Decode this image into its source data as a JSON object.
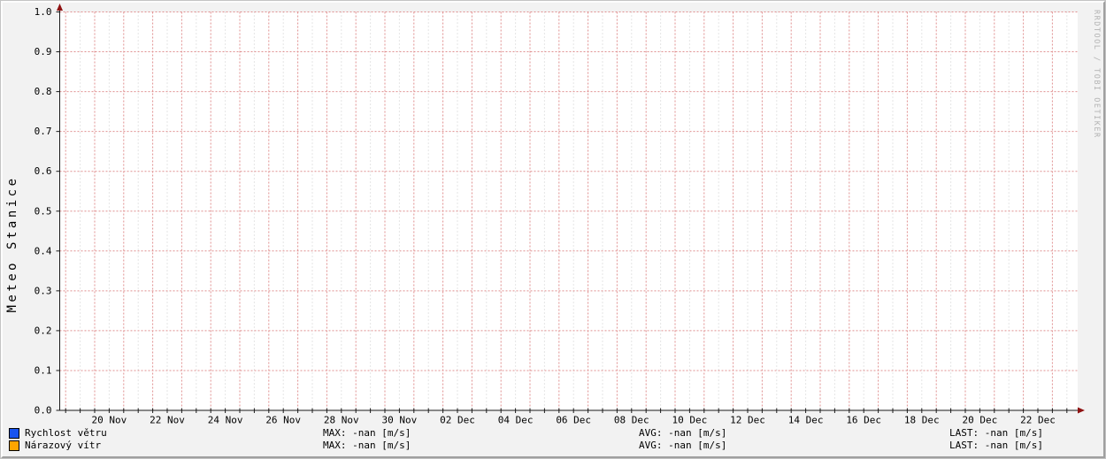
{
  "window": {
    "background_color": "#f2f2f2",
    "plot_background_color": "#ffffff"
  },
  "chart_data": {
    "type": "line",
    "title": "",
    "ylabel": "Meteo Stanice",
    "xlabel": "",
    "ylim": [
      0.0,
      1.0
    ],
    "y_tick_interval": 0.1,
    "y_tick_labels": [
      "0.0",
      "0.1",
      "0.2",
      "0.3",
      "0.4",
      "0.5",
      "0.6",
      "0.7",
      "0.8",
      "0.9",
      "1.0"
    ],
    "x_tick_labels": [
      "20 Nov",
      "22 Nov",
      "24 Nov",
      "26 Nov",
      "28 Nov",
      "30 Nov",
      "02 Dec",
      "04 Dec",
      "06 Dec",
      "08 Dec",
      "10 Dec",
      "12 Dec",
      "14 Dec",
      "16 Dec",
      "18 Dec",
      "20 Dec",
      "22 Dec"
    ],
    "x_days_per_label": 2,
    "grid": {
      "grid_on": true,
      "major_color": "#e09090",
      "minor_color": "#cccccc",
      "major_vertical_lines": 35,
      "minor_vertical_lines": 35
    },
    "axis_color": "#1a1a1a",
    "arrow_color": "#8f1212",
    "series": [
      {
        "name": "Rychlost větru",
        "color": "#1853f0",
        "values": []
      },
      {
        "name": "Nárazový vítr",
        "color": "#ffa500",
        "values": []
      }
    ],
    "watermark": "RRDTOOL / TOBI OETIKER"
  },
  "legend": {
    "rows": [
      {
        "label": "Rychlost větru",
        "swatch_color": "#1853f0",
        "max": "MAX: -nan [m/s]",
        "avg": "AVG: -nan [m/s]",
        "last": "LAST: -nan [m/s]"
      },
      {
        "label": "Nárazový vítr",
        "swatch_color": "#ffa500",
        "max": "MAX: -nan [m/s]",
        "avg": "AVG: -nan [m/s]",
        "last": "LAST: -nan [m/s]"
      }
    ]
  }
}
